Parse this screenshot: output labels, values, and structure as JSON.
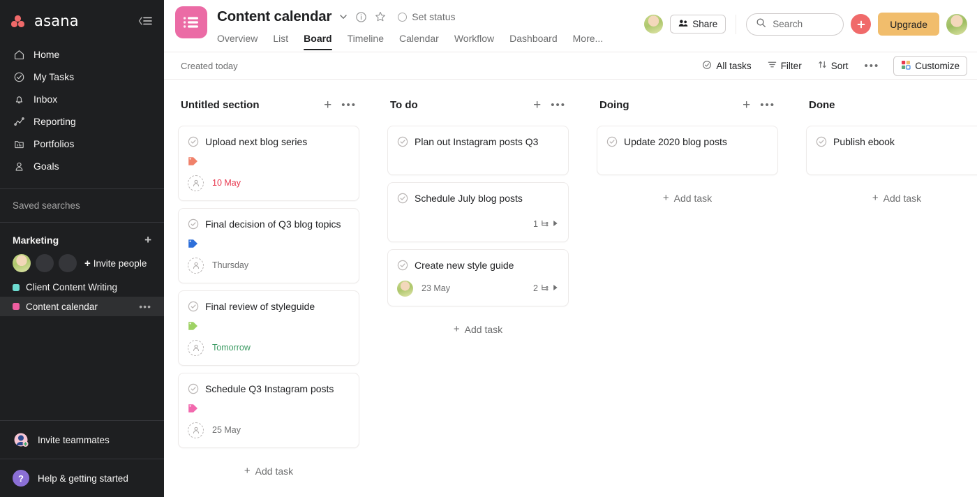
{
  "sidebar": {
    "brand": "asana",
    "collapse_icon": "collapse-sidebar-icon",
    "nav": [
      {
        "label": "Home",
        "icon": "home-icon"
      },
      {
        "label": "My Tasks",
        "icon": "check-circle-icon"
      },
      {
        "label": "Inbox",
        "icon": "bell-icon"
      },
      {
        "label": "Reporting",
        "icon": "chart-line-icon"
      },
      {
        "label": "Portfolios",
        "icon": "portfolio-icon"
      },
      {
        "label": "Goals",
        "icon": "goal-person-icon"
      }
    ],
    "saved_searches_label": "Saved searches",
    "team": {
      "name": "Marketing",
      "add_icon": "plus-icon",
      "invite_people_label": "Invite people",
      "invite_icon": "plus-icon"
    },
    "projects": [
      {
        "label": "Client Content Writing",
        "color": "#6ddbd0",
        "active": false
      },
      {
        "label": "Content calendar",
        "color": "#ef5ea0",
        "active": true,
        "more_icon": "ellipsis-icon"
      }
    ],
    "bottom": [
      {
        "label": "Invite teammates",
        "icon": "invite-teammates-icon"
      },
      {
        "label": "Help & getting started",
        "icon": "help-question-icon"
      }
    ]
  },
  "header": {
    "project_icon": "list-board-icon",
    "project_icon_color": "#eb6ba5",
    "title": "Content calendar",
    "chevron_icon": "chevron-down-icon",
    "info_icon": "info-circle-icon",
    "star_icon": "star-icon",
    "set_status_label": "Set status",
    "tabs": [
      {
        "label": "Overview",
        "active": false
      },
      {
        "label": "List",
        "active": false
      },
      {
        "label": "Board",
        "active": true
      },
      {
        "label": "Timeline",
        "active": false
      },
      {
        "label": "Calendar",
        "active": false
      },
      {
        "label": "Workflow",
        "active": false
      },
      {
        "label": "Dashboard",
        "active": false
      },
      {
        "label": "More...",
        "active": false
      }
    ],
    "member_avatar": "member-avatar",
    "share_label": "Share",
    "share_icon": "people-icon",
    "search_placeholder": "Search",
    "search_value": "",
    "search_icon": "search-icon",
    "add_button_icon": "plus-icon",
    "upgrade_label": "Upgrade",
    "account_avatar": "account-avatar"
  },
  "toolbar": {
    "created_label": "Created today",
    "all_tasks_label": "All tasks",
    "all_tasks_icon": "check-circle-icon",
    "filter_label": "Filter",
    "filter_icon": "filter-icon",
    "sort_label": "Sort",
    "sort_icon": "sort-arrows-icon",
    "more_icon": "ellipsis-icon",
    "customize_label": "Customize",
    "customize_icon": "customize-grid-icon"
  },
  "board": {
    "add_task_label": "Add task",
    "columns": [
      {
        "title": "Untitled section",
        "add_icon": "plus-icon",
        "more_icon": "ellipsis-icon",
        "show_more": true,
        "tasks": [
          {
            "title": "Upload next blog series",
            "tag_color": "#f0816a",
            "due": "10 May",
            "due_style": "red",
            "assignee": "none"
          },
          {
            "title": "Final decision of Q3 blog topics",
            "tag_color": "#2e6fd9",
            "due": "Thursday",
            "due_style": "gray",
            "assignee": "none"
          },
          {
            "title": "Final review of styleguide",
            "tag_color": "#9ed264",
            "due": "Tomorrow",
            "due_style": "green",
            "assignee": "none"
          },
          {
            "title": "Schedule Q3 Instagram posts",
            "tag_color": "#f269ae",
            "due": "25 May",
            "due_style": "gray",
            "assignee": "none"
          }
        ]
      },
      {
        "title": "To do",
        "add_icon": "plus-icon",
        "more_icon": "ellipsis-icon",
        "show_more": true,
        "tasks": [
          {
            "title": "Plan out Instagram posts Q3",
            "tag_color": null,
            "due": null,
            "assignee": "none",
            "spacer": true
          },
          {
            "title": "Schedule July blog posts",
            "tag_color": null,
            "due": null,
            "assignee": "none",
            "subtask_count": "1",
            "subtask_icon": "subtask-icon",
            "expand_icon": "triangle-right-icon"
          },
          {
            "title": "Create new style guide",
            "tag_color": null,
            "due": "23 May",
            "due_style": "gray",
            "assignee": "photo",
            "subtask_count": "2",
            "subtask_icon": "subtask-icon",
            "expand_icon": "triangle-right-icon"
          }
        ]
      },
      {
        "title": "Doing",
        "add_icon": "plus-icon",
        "more_icon": "ellipsis-icon",
        "show_more": true,
        "tasks": [
          {
            "title": "Update 2020 blog posts",
            "tag_color": null,
            "due": null,
            "assignee": "none",
            "spacer": true
          }
        ]
      },
      {
        "title": "Done",
        "add_icon": "plus-icon",
        "more_icon": "ellipsis-icon",
        "show_more": false,
        "tasks": [
          {
            "title": "Publish ebook",
            "tag_color": null,
            "due": null,
            "assignee": "none",
            "spacer": true
          }
        ]
      }
    ]
  }
}
